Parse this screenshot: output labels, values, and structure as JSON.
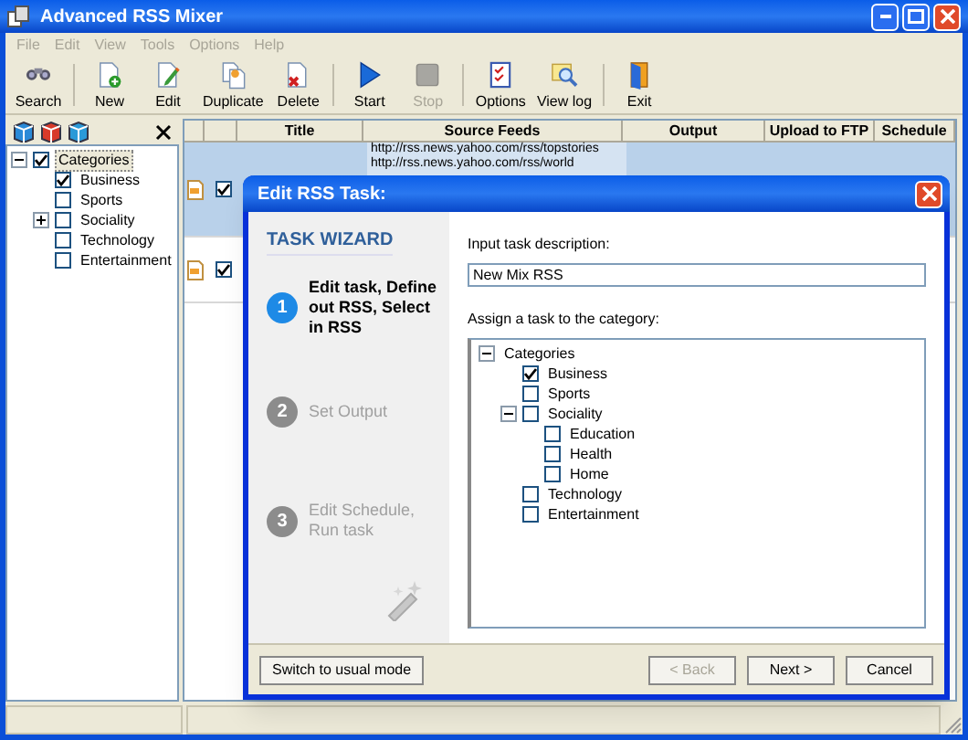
{
  "window": {
    "title": "Advanced RSS Mixer"
  },
  "menu": [
    {
      "label": "File",
      "disabled": true
    },
    {
      "label": "Edit",
      "disabled": true
    },
    {
      "label": "View",
      "disabled": true
    },
    {
      "label": "Tools",
      "disabled": true
    },
    {
      "label": "Options",
      "disabled": true
    },
    {
      "label": "Help",
      "disabled": true
    }
  ],
  "toolbar": {
    "groups": [
      [
        {
          "label": "Search",
          "disabled": false
        }
      ],
      [
        {
          "label": "New",
          "disabled": false
        },
        {
          "label": "Edit",
          "disabled": false
        },
        {
          "label": "Duplicate",
          "disabled": false
        },
        {
          "label": "Delete",
          "disabled": false
        }
      ],
      [
        {
          "label": "Start",
          "disabled": false
        },
        {
          "label": "Stop",
          "disabled": true
        }
      ],
      [
        {
          "label": "Options",
          "disabled": false
        },
        {
          "label": "View log",
          "disabled": false
        }
      ],
      [
        {
          "label": "Exit",
          "disabled": false
        }
      ]
    ]
  },
  "sidebar": {
    "tree": [
      {
        "label": "Categories",
        "checked": true,
        "selected": true,
        "expanded": true,
        "children": [
          {
            "label": "Business",
            "checked": true,
            "selected": false
          },
          {
            "label": "Sports",
            "checked": false,
            "selected": false
          },
          {
            "label": "Sociality",
            "checked": false,
            "selected": false,
            "expanded": false
          },
          {
            "label": "Technology",
            "checked": false,
            "selected": false
          },
          {
            "label": "Entertainment",
            "checked": false,
            "selected": false
          }
        ]
      }
    ]
  },
  "table": {
    "columns": [
      "Title",
      "Source Feeds",
      "Output",
      "Upload to FTP",
      "Schedule"
    ],
    "rows": [
      {
        "selected": true,
        "checked": true,
        "source_feeds": [
          "http://rss.news.yahoo.com/rss/topstories",
          "http://rss.news.yahoo.com/rss/world"
        ]
      },
      {
        "selected": false,
        "checked": true,
        "source_feeds": []
      }
    ]
  },
  "dialog": {
    "title": "Edit RSS Task:",
    "wizard_title": "TASK WIZARD",
    "steps": [
      {
        "number": "1",
        "label": "Edit task, Define out RSS, Select in RSS",
        "selected": true
      },
      {
        "number": "2",
        "label": "Set Output",
        "selected": false
      },
      {
        "number": "3",
        "label": "Edit Schedule, Run task",
        "selected": false
      }
    ],
    "description_label": "Input task description:",
    "description_value": "New Mix RSS",
    "category_label": "Assign a task to the category:",
    "tree": [
      {
        "label": "Categories",
        "selected": false,
        "expanded": true,
        "children": [
          {
            "label": "Business",
            "checked": true,
            "selected": false
          },
          {
            "label": "Sports",
            "checked": false,
            "selected": false
          },
          {
            "label": "Sociality",
            "checked": false,
            "selected": false,
            "expanded": true,
            "children": [
              {
                "label": "Education",
                "checked": false,
                "selected": false
              },
              {
                "label": "Health",
                "checked": false,
                "selected": false
              },
              {
                "label": "Home",
                "checked": false,
                "selected": false
              }
            ]
          },
          {
            "label": "Technology",
            "checked": false,
            "selected": false
          },
          {
            "label": "Entertainment",
            "checked": false,
            "selected": false
          }
        ]
      }
    ],
    "buttons": [
      {
        "label": "Switch to usual mode",
        "disabled": false
      },
      {
        "label": "< Back",
        "disabled": true
      },
      {
        "label": "Next >",
        "disabled": false
      },
      {
        "label": "Cancel",
        "disabled": false
      }
    ]
  }
}
